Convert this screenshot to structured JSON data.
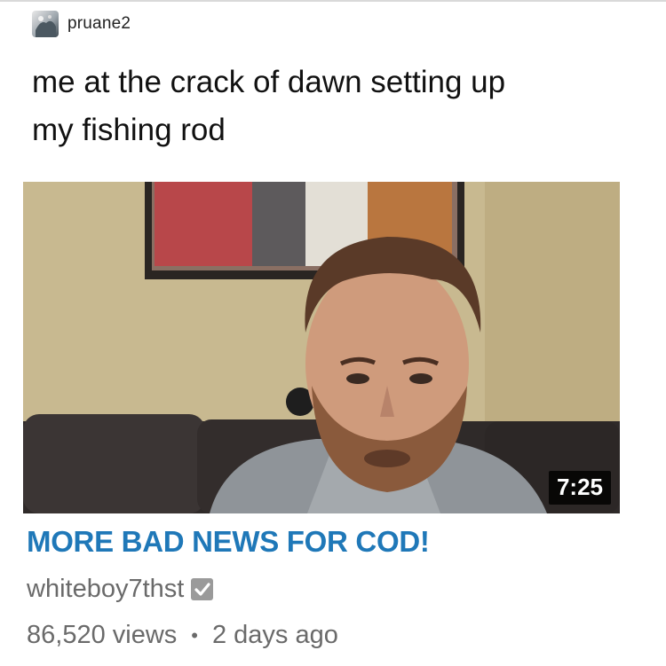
{
  "post": {
    "username": "pruane2",
    "caption_line1": "me at the crack of dawn setting up",
    "caption_line2": "my fishing rod"
  },
  "video": {
    "duration": "7:25",
    "title": "MORE BAD NEWS FOR COD!",
    "channel": "whiteboy7thst",
    "views": "86,520 views",
    "separator": "•",
    "age": "2 days ago"
  },
  "icons": {
    "avatar": "avatar-image",
    "verified": "verified-check-icon"
  },
  "colors": {
    "title": "#1f78b8",
    "meta_text": "#6a6a6a",
    "duration_bg": "#000000"
  }
}
